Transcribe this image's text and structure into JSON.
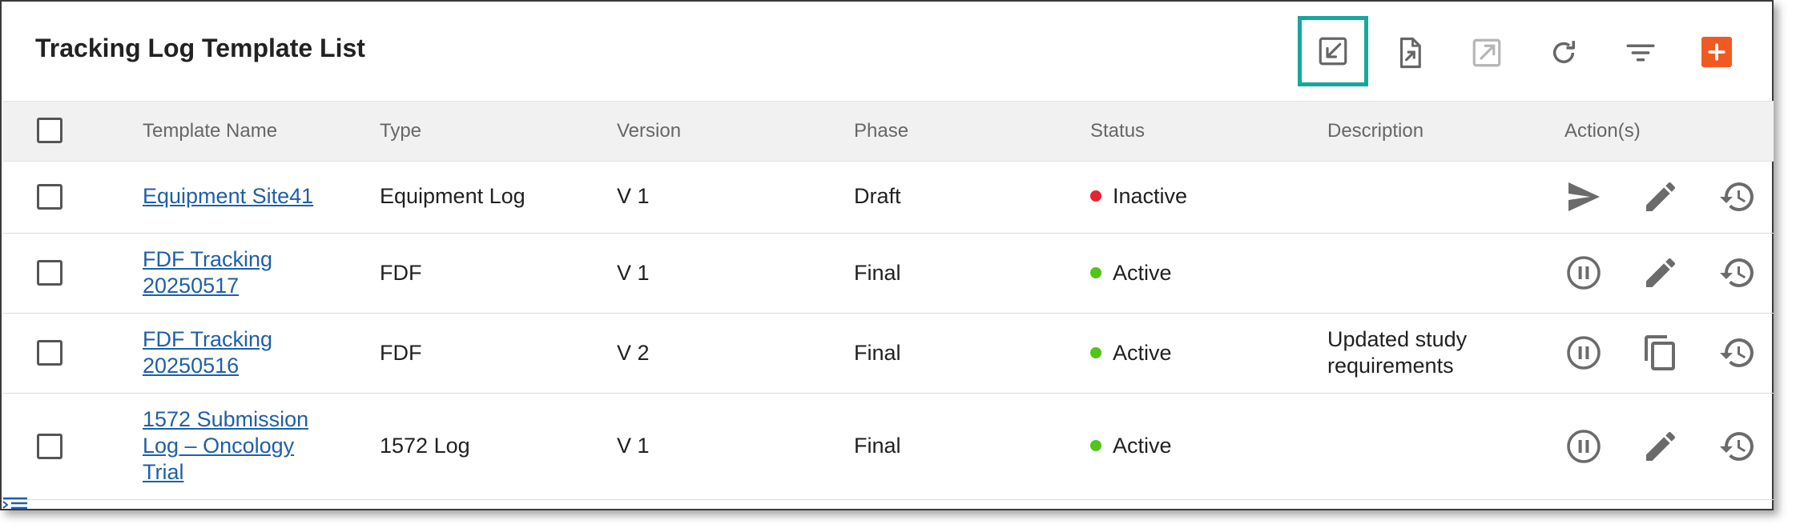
{
  "page": {
    "title": "Tracking Log Template List"
  },
  "toolbar": {
    "icons": [
      "import-icon",
      "export-file-icon",
      "open-external-icon",
      "refresh-icon",
      "filter-icon",
      "add-icon"
    ],
    "highlight_color": "#15a89b",
    "add_color": "#f05a22"
  },
  "table": {
    "headers": {
      "template_name": "Template Name",
      "type": "Type",
      "version": "Version",
      "phase": "Phase",
      "status": "Status",
      "description": "Description",
      "actions": "Action(s)"
    },
    "rows": [
      {
        "name_lines": [
          "Equipment Site41"
        ],
        "type": "Equipment Log",
        "version": "V 1",
        "phase": "Draft",
        "status": "Inactive",
        "status_color": "#e8212f",
        "description_lines": [],
        "actions": [
          "send-icon",
          "edit-icon",
          "history-icon"
        ]
      },
      {
        "name_lines": [
          "FDF Tracking",
          "20250517"
        ],
        "type": "FDF",
        "version": "V 1",
        "phase": "Final",
        "status": "Active",
        "status_color": "#52c41a",
        "description_lines": [],
        "actions": [
          "pause-icon",
          "edit-icon",
          "history-icon"
        ]
      },
      {
        "name_lines": [
          "FDF Tracking",
          "20250516"
        ],
        "type": "FDF",
        "version": "V 2",
        "phase": "Final",
        "status": "Active",
        "status_color": "#52c41a",
        "description_lines": [
          "Updated study",
          "requirements"
        ],
        "actions": [
          "pause-icon",
          "copy-icon",
          "history-icon"
        ]
      },
      {
        "name_lines": [
          "1572 Submission",
          "Log – Oncology",
          "Trial"
        ],
        "type": "1572 Log",
        "version": "V 1",
        "phase": "Final",
        "status": "Active",
        "status_color": "#52c41a",
        "description_lines": [],
        "actions": [
          "pause-icon",
          "edit-icon",
          "history-icon"
        ]
      }
    ]
  }
}
